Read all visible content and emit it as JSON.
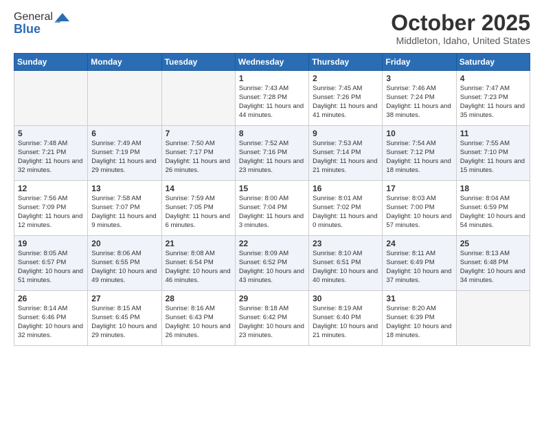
{
  "header": {
    "logo_general": "General",
    "logo_blue": "Blue",
    "month": "October 2025",
    "location": "Middleton, Idaho, United States"
  },
  "weekdays": [
    "Sunday",
    "Monday",
    "Tuesday",
    "Wednesday",
    "Thursday",
    "Friday",
    "Saturday"
  ],
  "weeks": [
    [
      {
        "day": "",
        "sunrise": "",
        "sunset": "",
        "daylight": "",
        "empty": true
      },
      {
        "day": "",
        "sunrise": "",
        "sunset": "",
        "daylight": "",
        "empty": true
      },
      {
        "day": "",
        "sunrise": "",
        "sunset": "",
        "daylight": "",
        "empty": true
      },
      {
        "day": "1",
        "sunrise": "Sunrise: 7:43 AM",
        "sunset": "Sunset: 7:28 PM",
        "daylight": "Daylight: 11 hours and 44 minutes.",
        "empty": false
      },
      {
        "day": "2",
        "sunrise": "Sunrise: 7:45 AM",
        "sunset": "Sunset: 7:26 PM",
        "daylight": "Daylight: 11 hours and 41 minutes.",
        "empty": false
      },
      {
        "day": "3",
        "sunrise": "Sunrise: 7:46 AM",
        "sunset": "Sunset: 7:24 PM",
        "daylight": "Daylight: 11 hours and 38 minutes.",
        "empty": false
      },
      {
        "day": "4",
        "sunrise": "Sunrise: 7:47 AM",
        "sunset": "Sunset: 7:23 PM",
        "daylight": "Daylight: 11 hours and 35 minutes.",
        "empty": false
      }
    ],
    [
      {
        "day": "5",
        "sunrise": "Sunrise: 7:48 AM",
        "sunset": "Sunset: 7:21 PM",
        "daylight": "Daylight: 11 hours and 32 minutes.",
        "empty": false
      },
      {
        "day": "6",
        "sunrise": "Sunrise: 7:49 AM",
        "sunset": "Sunset: 7:19 PM",
        "daylight": "Daylight: 11 hours and 29 minutes.",
        "empty": false
      },
      {
        "day": "7",
        "sunrise": "Sunrise: 7:50 AM",
        "sunset": "Sunset: 7:17 PM",
        "daylight": "Daylight: 11 hours and 26 minutes.",
        "empty": false
      },
      {
        "day": "8",
        "sunrise": "Sunrise: 7:52 AM",
        "sunset": "Sunset: 7:16 PM",
        "daylight": "Daylight: 11 hours and 23 minutes.",
        "empty": false
      },
      {
        "day": "9",
        "sunrise": "Sunrise: 7:53 AM",
        "sunset": "Sunset: 7:14 PM",
        "daylight": "Daylight: 11 hours and 21 minutes.",
        "empty": false
      },
      {
        "day": "10",
        "sunrise": "Sunrise: 7:54 AM",
        "sunset": "Sunset: 7:12 PM",
        "daylight": "Daylight: 11 hours and 18 minutes.",
        "empty": false
      },
      {
        "day": "11",
        "sunrise": "Sunrise: 7:55 AM",
        "sunset": "Sunset: 7:10 PM",
        "daylight": "Daylight: 11 hours and 15 minutes.",
        "empty": false
      }
    ],
    [
      {
        "day": "12",
        "sunrise": "Sunrise: 7:56 AM",
        "sunset": "Sunset: 7:09 PM",
        "daylight": "Daylight: 11 hours and 12 minutes.",
        "empty": false
      },
      {
        "day": "13",
        "sunrise": "Sunrise: 7:58 AM",
        "sunset": "Sunset: 7:07 PM",
        "daylight": "Daylight: 11 hours and 9 minutes.",
        "empty": false
      },
      {
        "day": "14",
        "sunrise": "Sunrise: 7:59 AM",
        "sunset": "Sunset: 7:05 PM",
        "daylight": "Daylight: 11 hours and 6 minutes.",
        "empty": false
      },
      {
        "day": "15",
        "sunrise": "Sunrise: 8:00 AM",
        "sunset": "Sunset: 7:04 PM",
        "daylight": "Daylight: 11 hours and 3 minutes.",
        "empty": false
      },
      {
        "day": "16",
        "sunrise": "Sunrise: 8:01 AM",
        "sunset": "Sunset: 7:02 PM",
        "daylight": "Daylight: 11 hours and 0 minutes.",
        "empty": false
      },
      {
        "day": "17",
        "sunrise": "Sunrise: 8:03 AM",
        "sunset": "Sunset: 7:00 PM",
        "daylight": "Daylight: 10 hours and 57 minutes.",
        "empty": false
      },
      {
        "day": "18",
        "sunrise": "Sunrise: 8:04 AM",
        "sunset": "Sunset: 6:59 PM",
        "daylight": "Daylight: 10 hours and 54 minutes.",
        "empty": false
      }
    ],
    [
      {
        "day": "19",
        "sunrise": "Sunrise: 8:05 AM",
        "sunset": "Sunset: 6:57 PM",
        "daylight": "Daylight: 10 hours and 51 minutes.",
        "empty": false
      },
      {
        "day": "20",
        "sunrise": "Sunrise: 8:06 AM",
        "sunset": "Sunset: 6:55 PM",
        "daylight": "Daylight: 10 hours and 49 minutes.",
        "empty": false
      },
      {
        "day": "21",
        "sunrise": "Sunrise: 8:08 AM",
        "sunset": "Sunset: 6:54 PM",
        "daylight": "Daylight: 10 hours and 46 minutes.",
        "empty": false
      },
      {
        "day": "22",
        "sunrise": "Sunrise: 8:09 AM",
        "sunset": "Sunset: 6:52 PM",
        "daylight": "Daylight: 10 hours and 43 minutes.",
        "empty": false
      },
      {
        "day": "23",
        "sunrise": "Sunrise: 8:10 AM",
        "sunset": "Sunset: 6:51 PM",
        "daylight": "Daylight: 10 hours and 40 minutes.",
        "empty": false
      },
      {
        "day": "24",
        "sunrise": "Sunrise: 8:11 AM",
        "sunset": "Sunset: 6:49 PM",
        "daylight": "Daylight: 10 hours and 37 minutes.",
        "empty": false
      },
      {
        "day": "25",
        "sunrise": "Sunrise: 8:13 AM",
        "sunset": "Sunset: 6:48 PM",
        "daylight": "Daylight: 10 hours and 34 minutes.",
        "empty": false
      }
    ],
    [
      {
        "day": "26",
        "sunrise": "Sunrise: 8:14 AM",
        "sunset": "Sunset: 6:46 PM",
        "daylight": "Daylight: 10 hours and 32 minutes.",
        "empty": false
      },
      {
        "day": "27",
        "sunrise": "Sunrise: 8:15 AM",
        "sunset": "Sunset: 6:45 PM",
        "daylight": "Daylight: 10 hours and 29 minutes.",
        "empty": false
      },
      {
        "day": "28",
        "sunrise": "Sunrise: 8:16 AM",
        "sunset": "Sunset: 6:43 PM",
        "daylight": "Daylight: 10 hours and 26 minutes.",
        "empty": false
      },
      {
        "day": "29",
        "sunrise": "Sunrise: 8:18 AM",
        "sunset": "Sunset: 6:42 PM",
        "daylight": "Daylight: 10 hours and 23 minutes.",
        "empty": false
      },
      {
        "day": "30",
        "sunrise": "Sunrise: 8:19 AM",
        "sunset": "Sunset: 6:40 PM",
        "daylight": "Daylight: 10 hours and 21 minutes.",
        "empty": false
      },
      {
        "day": "31",
        "sunrise": "Sunrise: 8:20 AM",
        "sunset": "Sunset: 6:39 PM",
        "daylight": "Daylight: 10 hours and 18 minutes.",
        "empty": false
      },
      {
        "day": "",
        "sunrise": "",
        "sunset": "",
        "daylight": "",
        "empty": true
      }
    ]
  ]
}
